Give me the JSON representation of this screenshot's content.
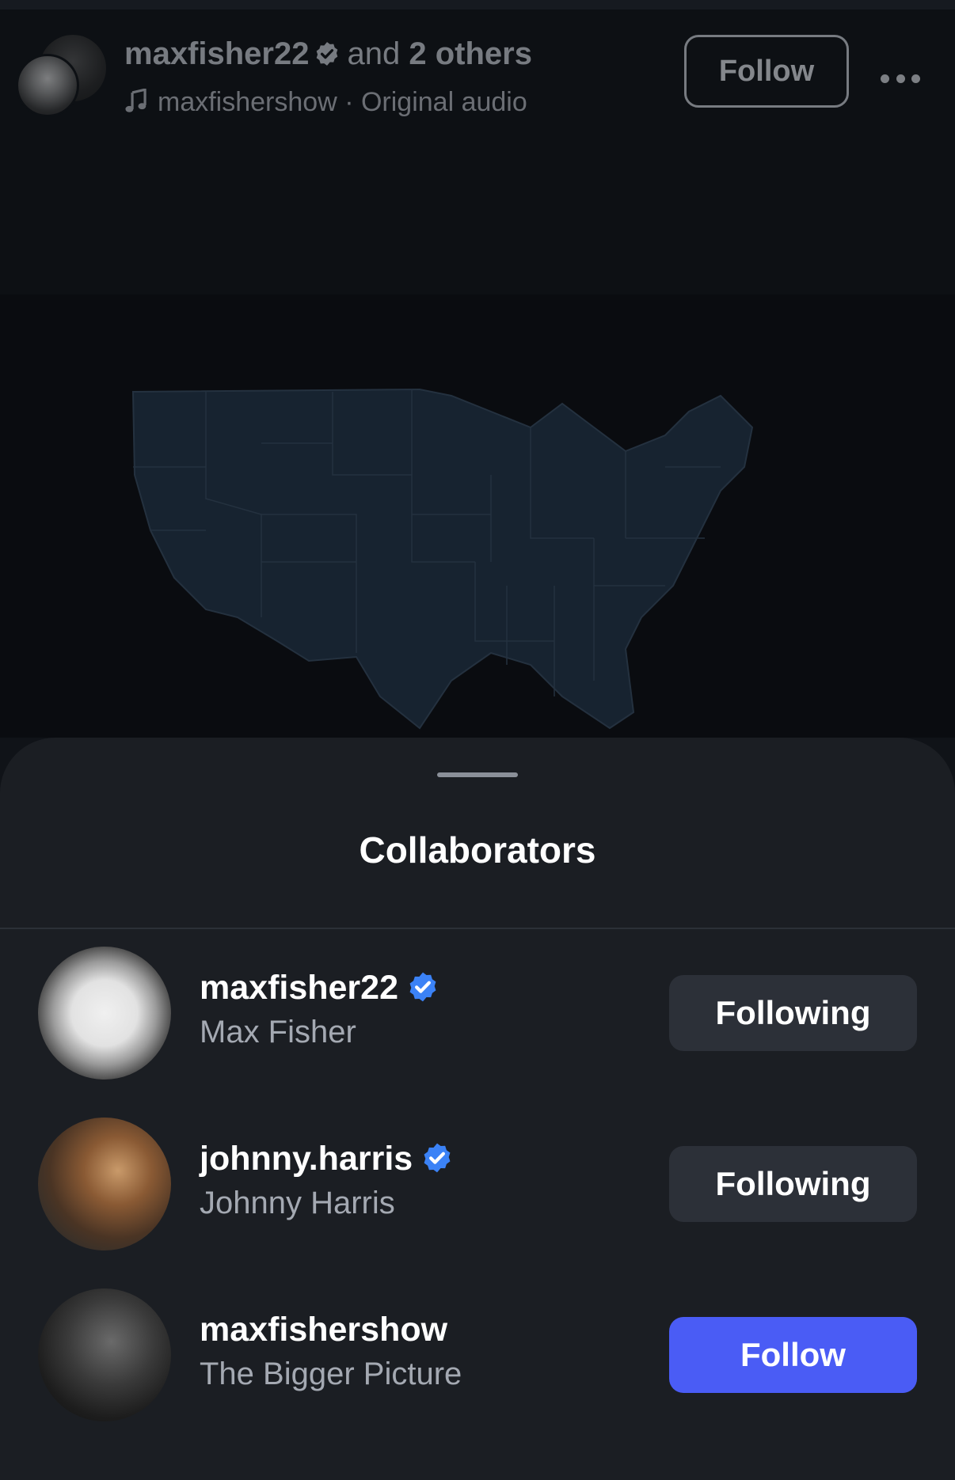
{
  "reel_header": {
    "primary_user": "maxfisher22",
    "and_text": "and",
    "others_text": "2 others",
    "audio_label": "maxfishershow · Original audio",
    "follow_label": "Follow"
  },
  "sheet": {
    "title": "Collaborators",
    "collaborators": [
      {
        "username": "maxfisher22",
        "display_name": "Max Fisher",
        "verified": true,
        "button_label": "Following"
      },
      {
        "username": "johnny.harris",
        "display_name": "Johnny Harris",
        "verified": true,
        "button_label": "Following"
      },
      {
        "username": "maxfishershow",
        "display_name": "The Bigger Picture",
        "verified": false,
        "button_label": "Follow"
      }
    ]
  },
  "colors": {
    "background": "#101318",
    "sheet": "#1b1e23",
    "following_button": "#2c3038",
    "follow_button": "#4a5cf5",
    "verified_badge": "#3b82f6"
  }
}
